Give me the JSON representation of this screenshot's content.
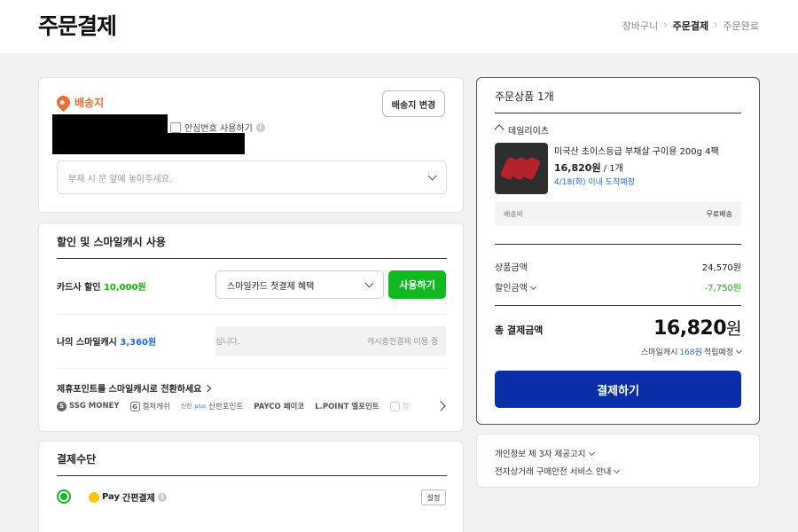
{
  "header": {
    "title": "주문결제",
    "breadcrumb": [
      "장바구니",
      "주문결제",
      "주문완료"
    ]
  },
  "shipping": {
    "title": "배송지",
    "change_button": "배송지 변경",
    "safe_number_label": "안심번호 사용하기",
    "memo_placeholder": "부재 시 문 앞에 놓아주세요."
  },
  "discount": {
    "title": "할인 및 스마일캐시 사용",
    "card_label": "카드사 할인",
    "card_amount": "10,000원",
    "card_select": "스마일카드 첫결제 혜택",
    "use_button": "사용하기",
    "cash_label": "나의 스마일캐시",
    "cash_amount": "3,360원",
    "cash_field_left": "십니다.",
    "cash_field_right": "캐시충전결제 이용 중",
    "convert_text": "제휴포인트를 스마일캐시로 전환하세요",
    "partners": [
      {
        "icon": "S",
        "name": "SSG MONEY"
      },
      {
        "icon": "G",
        "name": "컬처캐쉬"
      },
      {
        "icon": "",
        "name": "신한포인트"
      },
      {
        "icon": "",
        "name": "PAYCO 페이코"
      },
      {
        "icon": "",
        "name": "L.POINT 엘포인트"
      },
      {
        "icon": "",
        "name": "정"
      }
    ],
    "partner_prefix": "신한",
    "partner_prefix_sub": "plus"
  },
  "payment": {
    "title": "결제수단",
    "pay_brand": "Pay",
    "pay_label": "간편결제",
    "setting_button": "설정"
  },
  "summary": {
    "title": "주문상품 1개",
    "shop": "데일리이츠",
    "product_name": "미국산 초이스등급 부채살 구이용 200g 4팩",
    "product_price": "16,820원",
    "product_qty": " / 1개",
    "eta": "4/18(화) 이내 도착예정",
    "ship_fee_label": "배송비",
    "ship_fee_value": "무료배송",
    "goods_label": "상품금액",
    "goods_value": "24,570원",
    "discount_label": "할인금액",
    "discount_value": "-7,750원",
    "total_label": "총 결제금액",
    "total_value": "16,820",
    "total_unit": "원",
    "earn_prefix": "스마일캐시",
    "earn_amount": "168원",
    "earn_suffix": "적립예정",
    "pay_button": "결제하기"
  },
  "policy": {
    "privacy": "개인정보 제 3자 제공고지",
    "safety": "전자상거래 구매안전 서비스 안내"
  },
  "colors": {
    "accent_orange": "#f26a3a",
    "green": "#12b822",
    "blue_text": "#1e6fd9",
    "pay_button": "#0a2ea8"
  }
}
